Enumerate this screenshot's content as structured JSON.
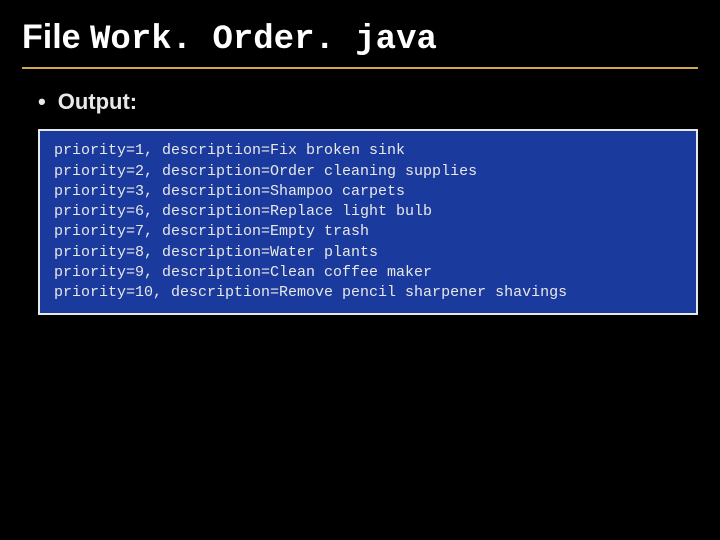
{
  "title": {
    "prefix": "File ",
    "filename": "Work. Order. java"
  },
  "bullet": {
    "marker": "•",
    "label": "Output:"
  },
  "output_lines": [
    "priority=1, description=Fix broken sink",
    "priority=2, description=Order cleaning supplies",
    "priority=3, description=Shampoo carpets",
    "priority=6, description=Replace light bulb",
    "priority=7, description=Empty trash",
    "priority=8, description=Water plants",
    "priority=9, description=Clean coffee maker",
    "priority=10, description=Remove pencil sharpener shavings"
  ]
}
